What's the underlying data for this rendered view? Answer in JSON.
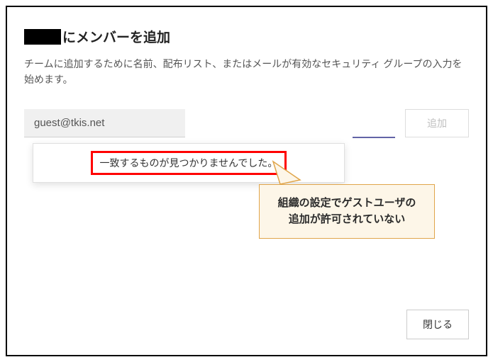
{
  "dialog": {
    "title": "にメンバーを追加",
    "subtitle": "チームに追加するために名前、配布リスト、またはメールが有効なセキュリティ グループの入力を始めます。",
    "input_value": "guest@tkis.net",
    "add_button": "追加",
    "no_match": "一致するものが見つかりませんでした。",
    "close_button": "閉じる"
  },
  "annotation": {
    "callout_line1": "組織の設定でゲストユーザの",
    "callout_line2": "追加が許可されていない"
  }
}
